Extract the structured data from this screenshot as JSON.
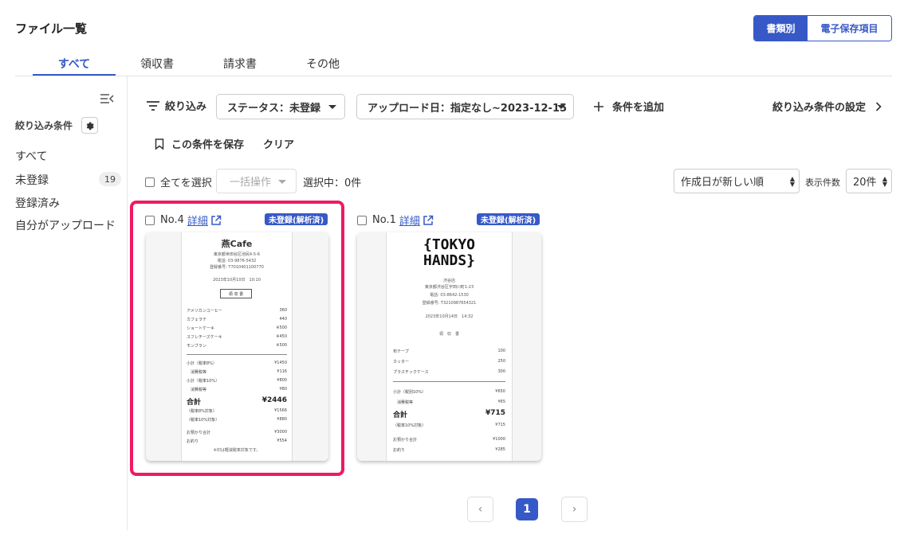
{
  "page_title": "ファイル一覧",
  "view_toggle": {
    "by_document": "書類別",
    "e_storage": "電子保存項目"
  },
  "tabs": [
    {
      "label": "すべて"
    },
    {
      "label": "領収書"
    },
    {
      "label": "請求書"
    },
    {
      "label": "その他"
    }
  ],
  "sidebar": {
    "filter_conditions_label": "絞り込み条件",
    "items": [
      {
        "label": "すべて"
      },
      {
        "label": "未登録",
        "count": "19"
      },
      {
        "label": "登録済み"
      },
      {
        "label": "自分がアップロード"
      }
    ]
  },
  "filters": {
    "filter_label": "絞り込み",
    "status_dropdown": "ステータス：未登録",
    "upload_date_dropdown": "アップロード日：指定なし~2023-12-15",
    "add_condition": "条件を追加",
    "filter_settings": "絞り込み条件の設定",
    "save_condition": "この条件を保存",
    "clear": "クリア"
  },
  "list_controls": {
    "select_all": "全てを選択",
    "bulk_action": "一括操作",
    "selected_count": "選択中：0件",
    "sort": "作成日が新しい順",
    "per_page_label": "表示件数",
    "per_page": "20件"
  },
  "cards": [
    {
      "no": "No.4",
      "detail": "詳細",
      "status": "未登録(解析済)",
      "receipt": {
        "shop": "燕Cafe",
        "address_lines": [
          "東京都世田谷区池尻4-5-6",
          "電話: 03-9876-5432",
          "登録番号: T7010401100770"
        ],
        "datetime": "2023年10月10日　10:10",
        "doc_type": "領 収 書",
        "items": [
          {
            "name": "アメリカンコーヒー",
            "price": "360"
          },
          {
            "name": "カフェラテ",
            "price": "440"
          },
          {
            "name": "ショートケーキ",
            "price": "※500"
          },
          {
            "name": "スフレチーズケーキ",
            "price": "※450"
          },
          {
            "name": "モンブラン",
            "price": "※500"
          }
        ],
        "subtotals": [
          {
            "name": "小計（税率8%）",
            "price": "¥1450"
          },
          {
            "name": "　消費税等",
            "price": "¥116"
          },
          {
            "name": "小計（税率10%）",
            "price": "¥800"
          },
          {
            "name": "　消費税等",
            "price": "¥80"
          }
        ],
        "total_label": "合計",
        "total": "¥2446",
        "tax_breakdown": [
          {
            "name": "（税率8%対象）",
            "price": "¥1566"
          },
          {
            "name": "（税率10%対象）",
            "price": "¥880"
          }
        ],
        "payment": [
          {
            "name": "お預かり合計",
            "price": "¥3000"
          },
          {
            "name": "お釣り",
            "price": "¥554"
          }
        ],
        "footnote": "※印は軽減税率対象です。"
      }
    },
    {
      "no": "No.1",
      "detail": "詳細",
      "status": "未登録(解析済)",
      "receipt": {
        "logo_line1": "{TOKYO",
        "logo_line2": "HANDS}",
        "shop": "渋谷店",
        "address_lines": [
          "東京都渋谷区宇田川町1-23",
          "電話: 03-8642-1530",
          "登録番号: T3210987654321"
        ],
        "datetime": "2023年10月14日　14:32",
        "doc_type": "領　収　書",
        "items": [
          {
            "name": "布テープ",
            "price": "100"
          },
          {
            "name": "カッター",
            "price": "250"
          },
          {
            "name": "プラスチックケース",
            "price": "300"
          }
        ],
        "subtotals": [
          {
            "name": "小計（税別10%）",
            "price": "¥650"
          },
          {
            "name": "　消費税等",
            "price": "¥65"
          }
        ],
        "total_label": "合計",
        "total": "¥715",
        "tax_breakdown": [
          {
            "name": "（税率10%対象）",
            "price": "¥715"
          }
        ],
        "payment": [
          {
            "name": "お預かり合計",
            "price": "¥1000"
          },
          {
            "name": "お釣り",
            "price": "¥285"
          }
        ]
      }
    }
  ],
  "pagination": {
    "prev": "‹",
    "current": "1",
    "next": "›"
  },
  "colors": {
    "primary": "#3759c7",
    "highlight": "#ef1a63"
  }
}
